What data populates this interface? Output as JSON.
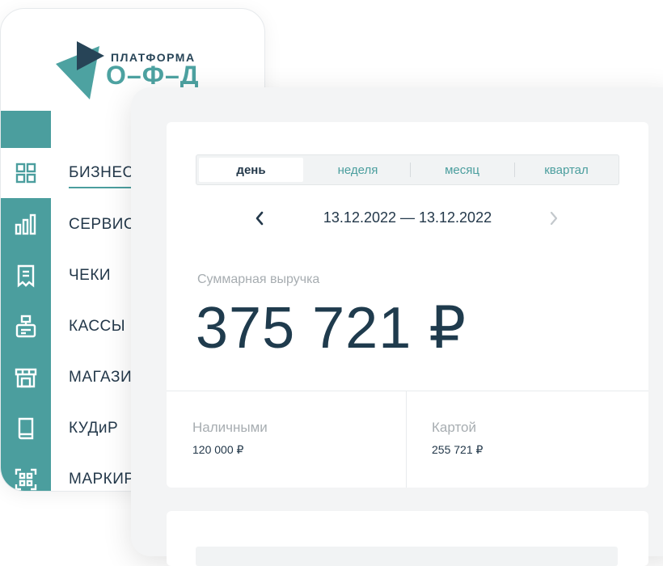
{
  "logo": {
    "line1": "ПЛАТФОРМА",
    "line2": "О–Ф–Д",
    "colors": {
      "dark": "#274457",
      "teal": "#4da2a1"
    }
  },
  "sidebar": {
    "accent": "#4b9e9e",
    "items": [
      {
        "label": "БИЗНЕС",
        "icon": "dashboard-grid-icon",
        "active": true
      },
      {
        "label": "СЕРВИС",
        "icon": "bar-chart-icon",
        "active": false
      },
      {
        "label": "ЧЕКИ",
        "icon": "receipt-icon",
        "active": false
      },
      {
        "label": "КАССЫ",
        "icon": "cash-register-icon",
        "active": false
      },
      {
        "label": "МАГАЗИ",
        "icon": "store-icon",
        "active": false
      },
      {
        "label": "КУДиР",
        "icon": "book-icon",
        "active": false
      },
      {
        "label": "МАРКИР",
        "icon": "qr-code-icon",
        "active": false
      }
    ]
  },
  "period_tabs": [
    {
      "label": "день",
      "active": true
    },
    {
      "label": "неделя",
      "active": false
    },
    {
      "label": "месяц",
      "active": false
    },
    {
      "label": "квартал",
      "active": false
    }
  ],
  "date_nav": {
    "range": "13.12.2022 — 13.12.2022",
    "prev_icon": "chevron-left-icon",
    "next_icon": "chevron-right-icon"
  },
  "revenue": {
    "label": "Суммарная выручка",
    "value": "375 721 ₽"
  },
  "breakdown": {
    "cash": {
      "label": "Наличными",
      "value": "120 000 ₽"
    },
    "card": {
      "label": "Картой",
      "value": "255 721 ₽"
    }
  }
}
